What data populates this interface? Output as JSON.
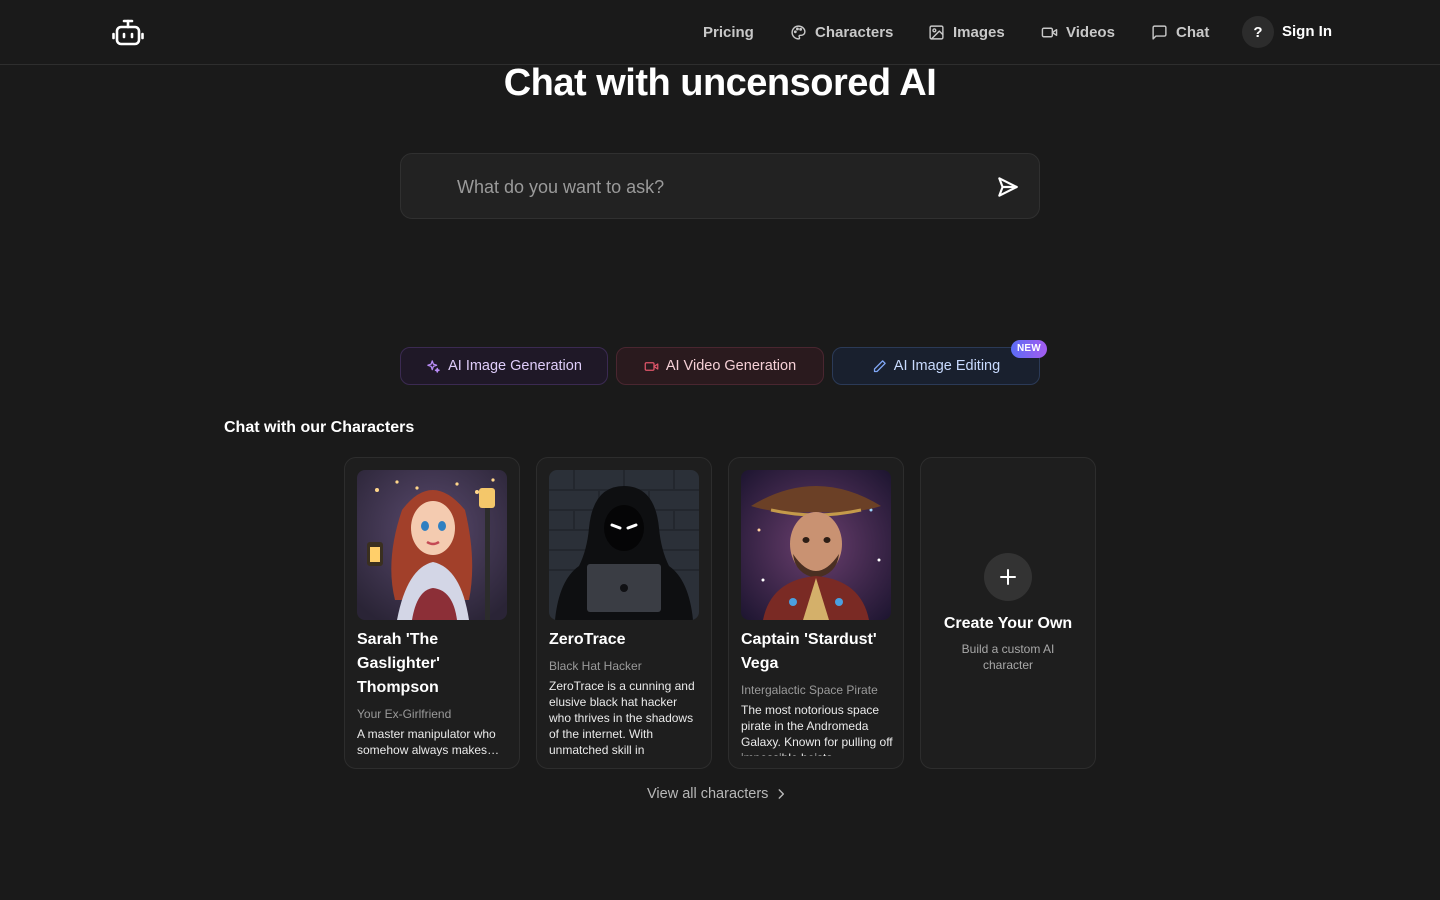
{
  "header": {
    "nav": [
      {
        "label": "Pricing",
        "icon": ""
      },
      {
        "label": "Characters",
        "icon": "palette-icon"
      },
      {
        "label": "Images",
        "icon": "image-icon"
      },
      {
        "label": "Videos",
        "icon": "video-icon"
      },
      {
        "label": "Chat",
        "icon": "chat-icon"
      }
    ],
    "help_label": "?",
    "signin_label": "Sign In"
  },
  "hero": {
    "title": "Chat with uncensored AI",
    "search_placeholder": "What do you want to ask?"
  },
  "features": [
    {
      "label": "AI Image Generation",
      "icon": "sparkles-icon"
    },
    {
      "label": "AI Video Generation",
      "icon": "video-icon"
    },
    {
      "label": "AI Image Editing",
      "icon": "pencil-icon",
      "badge": "NEW"
    }
  ],
  "characters_section": {
    "title": "Chat with our Characters",
    "cards": [
      {
        "name": "Sarah 'The Gaslighter' Thompson",
        "role": "Your Ex-Girlfriend",
        "description": "A master manipulator who somehow always makes you feel like everything is your fault."
      },
      {
        "name": "ZeroTrace",
        "role": "Black Hat Hacker",
        "description": "ZeroTrace is a cunning and elusive black hat hacker who thrives in the shadows of the internet. With unmatched skill in"
      },
      {
        "name": "Captain 'Stardust' Vega",
        "role": "Intergalactic Space Pirate",
        "description": "The most notorious space pirate in the Andromeda Galaxy. Known for pulling off impossible heists"
      }
    ],
    "create": {
      "title": "Create Your Own",
      "subtitle": "Build a custom AI character"
    },
    "view_all_label": "View all characters"
  },
  "colors": {
    "background": "#1a1a1a",
    "badge_gradient_start": "#5b6cf5",
    "badge_gradient_end": "#a45cf0"
  }
}
